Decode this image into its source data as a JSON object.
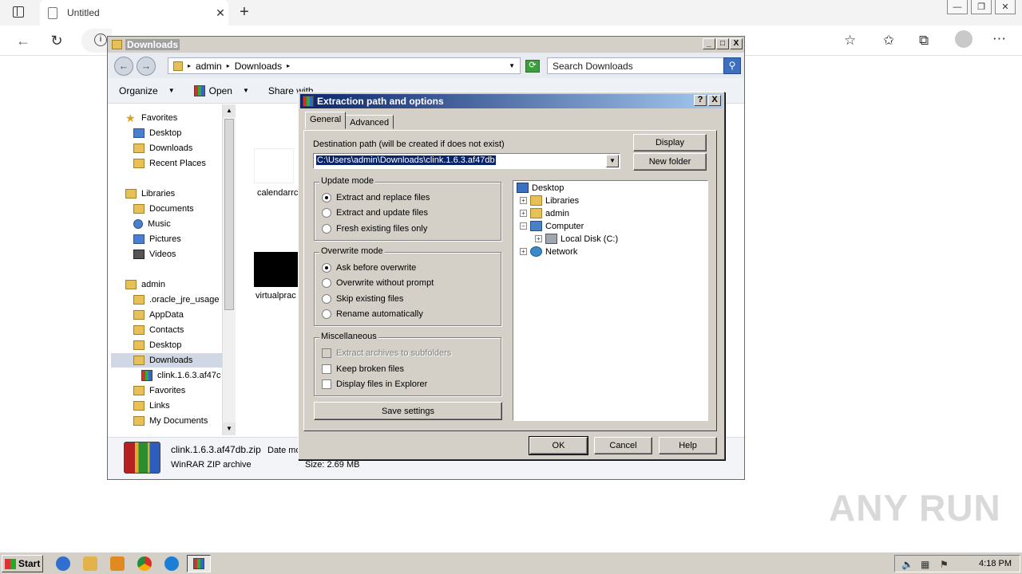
{
  "browser": {
    "tab_title": "Untitled",
    "tab_close": "✕",
    "new_tab": "+",
    "win_min": "—",
    "win_restore": "❐",
    "win_close": "✕",
    "back": "←",
    "reload": "↻",
    "info": "i"
  },
  "explorer": {
    "title": "Downloads",
    "title_btn_min": "_",
    "title_btn_max": "□",
    "title_btn_close": "X",
    "back": "←",
    "forward": "→",
    "breadcrumb": [
      "admin",
      "Downloads"
    ],
    "search_placeholder": "Search Downloads",
    "commands": [
      "Organize",
      "Open",
      "Share with"
    ],
    "nav_items": [
      {
        "label": "Favorites",
        "icon": "star"
      },
      {
        "label": "Desktop",
        "icon": "desktop"
      },
      {
        "label": "Downloads",
        "icon": "folder"
      },
      {
        "label": "Recent Places",
        "icon": "folder"
      },
      {
        "label": "Libraries",
        "icon": "folder"
      },
      {
        "label": "Documents",
        "icon": "folder"
      },
      {
        "label": "Music",
        "icon": "music"
      },
      {
        "label": "Pictures",
        "icon": "folder"
      },
      {
        "label": "Videos",
        "icon": "folder"
      },
      {
        "label": "admin",
        "icon": "folder"
      },
      {
        "label": ".oracle_jre_usage",
        "icon": "folder"
      },
      {
        "label": "AppData",
        "icon": "folder"
      },
      {
        "label": "Contacts",
        "icon": "folder"
      },
      {
        "label": "Desktop",
        "icon": "folder"
      },
      {
        "label": "Downloads",
        "icon": "folder"
      },
      {
        "label": "clink.1.6.3.af47c",
        "icon": "winrar"
      },
      {
        "label": "Favorites",
        "icon": "folder"
      },
      {
        "label": "Links",
        "icon": "folder"
      },
      {
        "label": "My Documents",
        "icon": "folder"
      }
    ],
    "files": [
      {
        "label": "calendarrc"
      },
      {
        "label": "virtualprac"
      }
    ],
    "details": {
      "name": "clink.1.6.3.af47db.zip",
      "date_label": "Date mo",
      "type": "WinRAR ZIP archive",
      "size": "Size: 2.69 MB"
    }
  },
  "dialog": {
    "title": "Extraction path and options",
    "help_btn": "?",
    "close_btn": "X",
    "tabs": [
      "General",
      "Advanced"
    ],
    "dest_label": "Destination path (will be created if does not exist)",
    "dest_value": "C:\\Users\\admin\\Downloads\\clink.1.6.3.af47db",
    "display_btn": "Display",
    "newfolder_btn": "New folder",
    "update_mode": {
      "title": "Update mode",
      "options": [
        "Extract and replace files",
        "Extract and update files",
        "Fresh existing files only"
      ],
      "selected": 0
    },
    "overwrite_mode": {
      "title": "Overwrite mode",
      "options": [
        "Ask before overwrite",
        "Overwrite without prompt",
        "Skip existing files",
        "Rename automatically"
      ],
      "selected": 0
    },
    "misc": {
      "title": "Miscellaneous",
      "options": [
        "Extract archives to subfolders",
        "Keep broken files",
        "Display files in Explorer"
      ]
    },
    "save_btn": "Save settings",
    "tree": [
      "Desktop",
      "Libraries",
      "admin",
      "Computer",
      "Local Disk (C:)",
      "Network"
    ],
    "ok_btn": "OK",
    "cancel_btn": "Cancel",
    "help_button": "Help"
  },
  "taskbar": {
    "start": "Start",
    "clock": "4:18 PM"
  },
  "watermark": "ANY RUN"
}
